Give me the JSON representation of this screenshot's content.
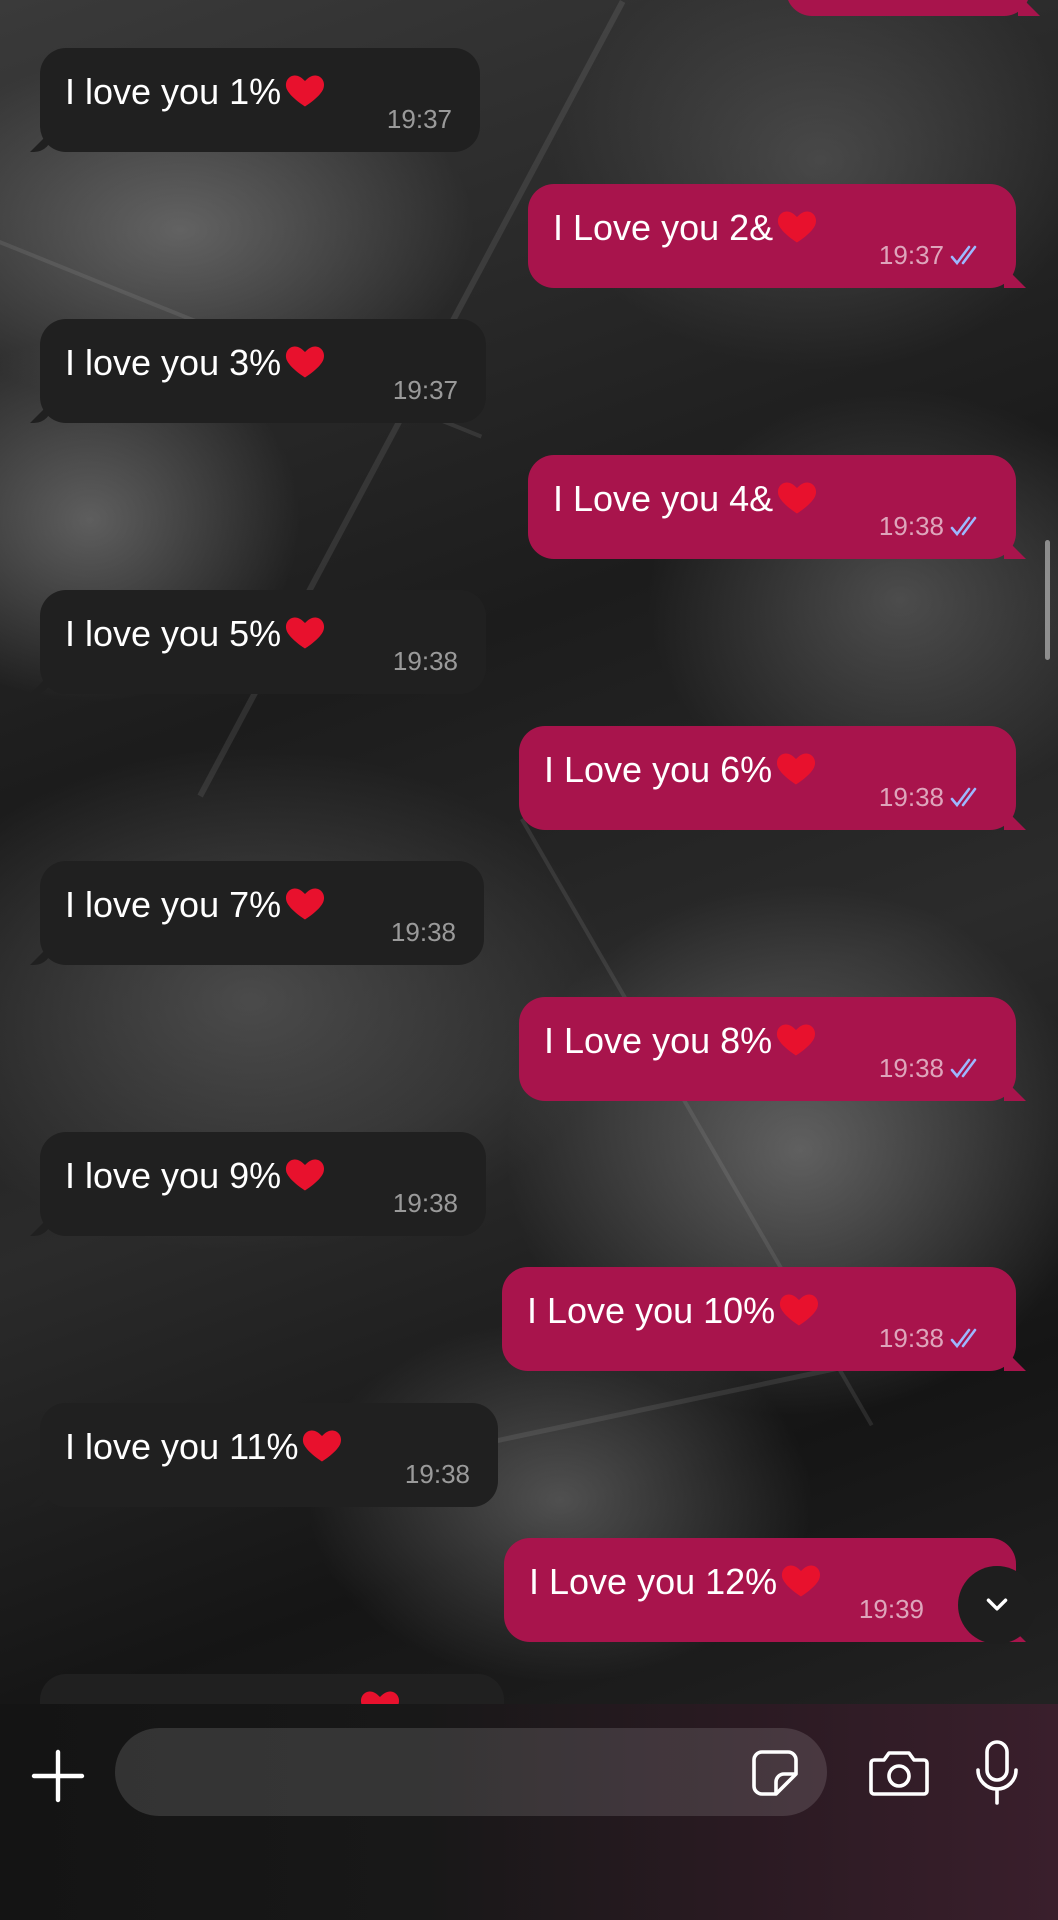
{
  "colors": {
    "incoming_bubble": "#202020",
    "outgoing_bubble": "#a8144c",
    "read_ticks": "#9db8ff"
  },
  "messages": [
    {
      "direction": "out",
      "text": "",
      "time": "",
      "partial": true
    },
    {
      "direction": "in",
      "text": "I love you 1%",
      "emoji": "heart-icon",
      "time": "19:37"
    },
    {
      "direction": "out",
      "text": "I Love you 2&",
      "emoji": "heart-icon",
      "time": "19:37",
      "status": "read-double-check-icon"
    },
    {
      "direction": "in",
      "text": "I love you 3%",
      "emoji": "heart-icon",
      "time": "19:37"
    },
    {
      "direction": "out",
      "text": "I Love you 4&",
      "emoji": "heart-icon",
      "time": "19:38",
      "status": "read-double-check-icon"
    },
    {
      "direction": "in",
      "text": "I love you 5%",
      "emoji": "heart-icon",
      "time": "19:38"
    },
    {
      "direction": "out",
      "text": "I Love you 6%",
      "emoji": "heart-icon",
      "time": "19:38",
      "status": "read-double-check-icon"
    },
    {
      "direction": "in",
      "text": "I love you 7%",
      "emoji": "heart-icon",
      "time": "19:38"
    },
    {
      "direction": "out",
      "text": "I Love you 8%",
      "emoji": "heart-icon",
      "time": "19:38",
      "status": "read-double-check-icon"
    },
    {
      "direction": "in",
      "text": "I love you 9%",
      "emoji": "heart-icon",
      "time": "19:38"
    },
    {
      "direction": "out",
      "text": "I Love you 10%",
      "emoji": "heart-icon",
      "time": "19:38",
      "status": "read-double-check-icon"
    },
    {
      "direction": "in",
      "text": "I love you 11%",
      "emoji": "heart-icon",
      "time": "19:38"
    },
    {
      "direction": "out",
      "text": "I Love you 12%",
      "emoji": "heart-icon",
      "time": "19:39",
      "status": "read-double-check-icon"
    },
    {
      "direction": "in",
      "text": "",
      "time": "",
      "partial": true
    }
  ],
  "composer": {
    "message_value": "",
    "message_placeholder": "",
    "icons": [
      "plus-icon",
      "sticker-icon",
      "camera-icon",
      "microphone-icon"
    ]
  },
  "scroll_down_icon": "chevron-down-icon"
}
